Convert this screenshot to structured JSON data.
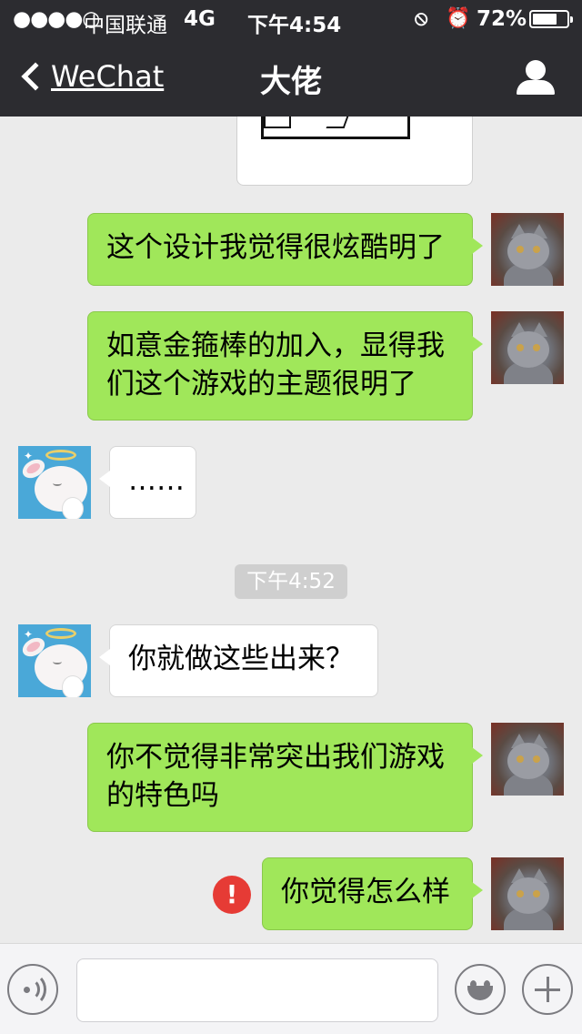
{
  "status_bar": {
    "signal": "●●●●○",
    "carrier": "中国联通",
    "network": "4G",
    "time": "下午4:54",
    "lock_icon": "⦸",
    "alarm_icon": "⏰",
    "battery_percent": "72%",
    "battery_level": 0.72
  },
  "nav": {
    "back_label": "WeChat",
    "title": "大佬"
  },
  "chat": {
    "image_message": {
      "caption": "凵"
    },
    "messages": [
      {
        "id": "m1",
        "side": "out",
        "text": "这个设计我觉得很炫酷明了"
      },
      {
        "id": "m2",
        "side": "out",
        "text": "如意金箍棒的加入，显得我们这个游戏的主题很明了"
      },
      {
        "id": "m3",
        "side": "in",
        "text": "……"
      },
      {
        "id": "m4",
        "side": "in",
        "text": "你就做这些出来？"
      },
      {
        "id": "m5",
        "side": "out",
        "text": "你不觉得非常突出我们游戏的特色吗"
      },
      {
        "id": "m6",
        "side": "out",
        "text": "你觉得怎么样",
        "failed": true
      }
    ],
    "timestamp": "下午4:52",
    "fail_mark": "!"
  },
  "input_bar": {
    "placeholder": ""
  },
  "colors": {
    "header_bg": "#2c2c30",
    "chat_bg": "#ebebeb",
    "outgoing_bubble": "#a0e75a",
    "incoming_bubble": "#ffffff",
    "fail_badge": "#e63b35"
  }
}
